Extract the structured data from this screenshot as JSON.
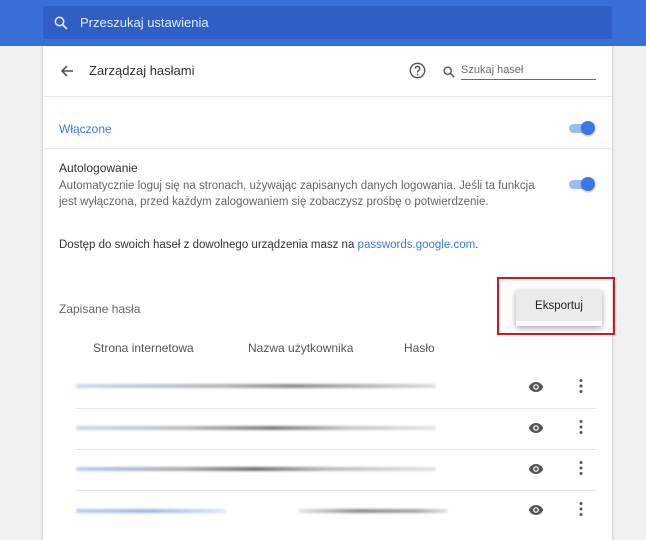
{
  "search": {
    "placeholder": "Przeszukaj ustawienia"
  },
  "header": {
    "title": "Zarządzaj hasłami",
    "search_placeholder": "Szukaj haseł"
  },
  "enabled": {
    "label": "Włączone",
    "on": true
  },
  "autologin": {
    "title": "Autologowanie",
    "description": "Automatycznie loguj się na stronach, używając zapisanych danych logowania. Jeśli ta funkcja jest wyłączona, przed każdym zalogowaniem się zobaczysz prośbę o potwierdzenie.",
    "on": true
  },
  "access": {
    "text": "Dostęp do swoich haseł z dowolnego urządzenia masz na ",
    "link": "passwords.google.com",
    "suffix": "."
  },
  "saved": {
    "label": "Zapisane hasła"
  },
  "menu": {
    "export_label": "Eksportuj"
  },
  "table": {
    "columns": [
      "Strona internetowa",
      "Nazwa użytkownika",
      "Hasło"
    ],
    "row_count": 4
  },
  "colors": {
    "accent": "#3b78e7",
    "topbar": "#3b6fd8",
    "highlight": "#e0101a"
  }
}
